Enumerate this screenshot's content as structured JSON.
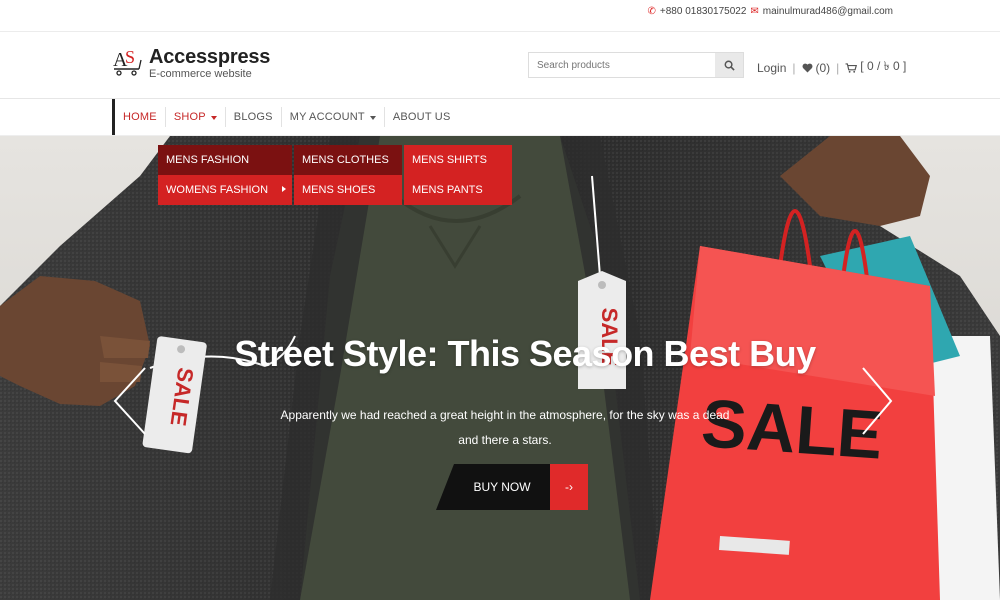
{
  "topbar": {
    "phone": "+880 01830175022",
    "email": "mainulmurad486@gmail.com"
  },
  "brand": {
    "title": "Accesspress",
    "subtitle": "E-commerce website",
    "mark": "AS"
  },
  "search": {
    "placeholder": "Search products"
  },
  "header_links": {
    "login": "Login",
    "wishlist_count": "(0)",
    "cart": "[ 0 / ৳ 0 ]"
  },
  "nav": {
    "items": [
      {
        "label": "HOME"
      },
      {
        "label": "SHOP"
      },
      {
        "label": "BLOGS"
      },
      {
        "label": "MY ACCOUNT"
      },
      {
        "label": "ABOUT US"
      }
    ]
  },
  "dropdown": {
    "level1": [
      "MENS FASHION",
      "WOMENS FASHION"
    ],
    "level2": [
      "MENS CLOTHES",
      "MENS SHOES"
    ],
    "level3": [
      "MENS SHIRTS",
      "MENS PANTS"
    ]
  },
  "hero": {
    "title": "Street Style: This Season Best Buy",
    "description": "Apparently we had reached a great height in the atmosphere, for the sky was a dead and there a stars.",
    "button_label": "BUY NOW",
    "button_arrow": "-›",
    "tag_text": "SALE",
    "bag_text": "SALE"
  },
  "colors": {
    "accent": "#d42222",
    "accent_dark": "#7b1111"
  }
}
